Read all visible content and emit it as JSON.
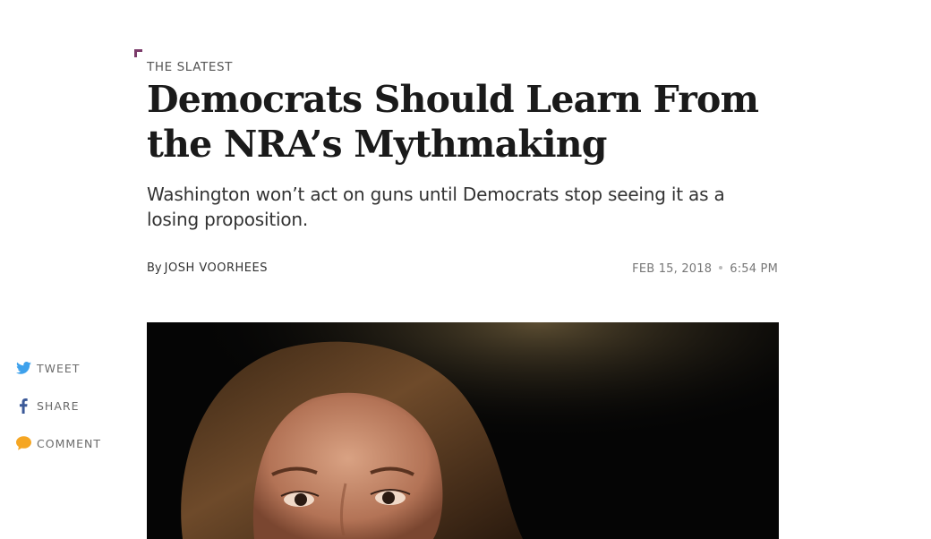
{
  "article": {
    "kicker": "THE SLATEST",
    "headline": "Democrats Should Learn From the NRA’s Mythmaking",
    "dek": "Washington won’t act on guns until Democrats stop seeing it as a losing proposition.",
    "byline_prefix": "By",
    "author": "JOSH VOORHEES",
    "date": "FEB 15, 2018",
    "time": "6:54 PM"
  },
  "social": {
    "items": [
      {
        "label": "TWEET",
        "icon": "twitter-icon",
        "color": "#3ea1ec"
      },
      {
        "label": "SHARE",
        "icon": "facebook-icon",
        "color": "#3b5998"
      },
      {
        "label": "COMMENT",
        "icon": "comment-icon",
        "color": "#f5a623"
      }
    ]
  },
  "colors": {
    "accent": "#7b3b6a",
    "text": "#1a1a1a",
    "muted": "#777777"
  }
}
